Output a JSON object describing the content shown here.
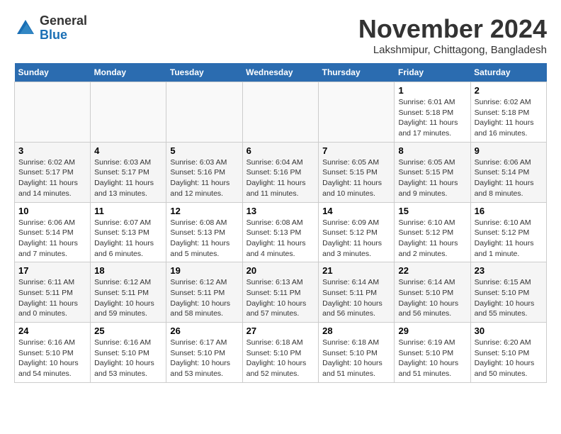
{
  "logo": {
    "general": "General",
    "blue": "Blue"
  },
  "header": {
    "month": "November 2024",
    "location": "Lakshmipur, Chittagong, Bangladesh"
  },
  "weekdays": [
    "Sunday",
    "Monday",
    "Tuesday",
    "Wednesday",
    "Thursday",
    "Friday",
    "Saturday"
  ],
  "weeks": [
    [
      {
        "day": "",
        "info": ""
      },
      {
        "day": "",
        "info": ""
      },
      {
        "day": "",
        "info": ""
      },
      {
        "day": "",
        "info": ""
      },
      {
        "day": "",
        "info": ""
      },
      {
        "day": "1",
        "info": "Sunrise: 6:01 AM\nSunset: 5:18 PM\nDaylight: 11 hours\nand 17 minutes."
      },
      {
        "day": "2",
        "info": "Sunrise: 6:02 AM\nSunset: 5:18 PM\nDaylight: 11 hours\nand 16 minutes."
      }
    ],
    [
      {
        "day": "3",
        "info": "Sunrise: 6:02 AM\nSunset: 5:17 PM\nDaylight: 11 hours\nand 14 minutes."
      },
      {
        "day": "4",
        "info": "Sunrise: 6:03 AM\nSunset: 5:17 PM\nDaylight: 11 hours\nand 13 minutes."
      },
      {
        "day": "5",
        "info": "Sunrise: 6:03 AM\nSunset: 5:16 PM\nDaylight: 11 hours\nand 12 minutes."
      },
      {
        "day": "6",
        "info": "Sunrise: 6:04 AM\nSunset: 5:16 PM\nDaylight: 11 hours\nand 11 minutes."
      },
      {
        "day": "7",
        "info": "Sunrise: 6:05 AM\nSunset: 5:15 PM\nDaylight: 11 hours\nand 10 minutes."
      },
      {
        "day": "8",
        "info": "Sunrise: 6:05 AM\nSunset: 5:15 PM\nDaylight: 11 hours\nand 9 minutes."
      },
      {
        "day": "9",
        "info": "Sunrise: 6:06 AM\nSunset: 5:14 PM\nDaylight: 11 hours\nand 8 minutes."
      }
    ],
    [
      {
        "day": "10",
        "info": "Sunrise: 6:06 AM\nSunset: 5:14 PM\nDaylight: 11 hours\nand 7 minutes."
      },
      {
        "day": "11",
        "info": "Sunrise: 6:07 AM\nSunset: 5:13 PM\nDaylight: 11 hours\nand 6 minutes."
      },
      {
        "day": "12",
        "info": "Sunrise: 6:08 AM\nSunset: 5:13 PM\nDaylight: 11 hours\nand 5 minutes."
      },
      {
        "day": "13",
        "info": "Sunrise: 6:08 AM\nSunset: 5:13 PM\nDaylight: 11 hours\nand 4 minutes."
      },
      {
        "day": "14",
        "info": "Sunrise: 6:09 AM\nSunset: 5:12 PM\nDaylight: 11 hours\nand 3 minutes."
      },
      {
        "day": "15",
        "info": "Sunrise: 6:10 AM\nSunset: 5:12 PM\nDaylight: 11 hours\nand 2 minutes."
      },
      {
        "day": "16",
        "info": "Sunrise: 6:10 AM\nSunset: 5:12 PM\nDaylight: 11 hours\nand 1 minute."
      }
    ],
    [
      {
        "day": "17",
        "info": "Sunrise: 6:11 AM\nSunset: 5:11 PM\nDaylight: 11 hours\nand 0 minutes."
      },
      {
        "day": "18",
        "info": "Sunrise: 6:12 AM\nSunset: 5:11 PM\nDaylight: 10 hours\nand 59 minutes."
      },
      {
        "day": "19",
        "info": "Sunrise: 6:12 AM\nSunset: 5:11 PM\nDaylight: 10 hours\nand 58 minutes."
      },
      {
        "day": "20",
        "info": "Sunrise: 6:13 AM\nSunset: 5:11 PM\nDaylight: 10 hours\nand 57 minutes."
      },
      {
        "day": "21",
        "info": "Sunrise: 6:14 AM\nSunset: 5:11 PM\nDaylight: 10 hours\nand 56 minutes."
      },
      {
        "day": "22",
        "info": "Sunrise: 6:14 AM\nSunset: 5:10 PM\nDaylight: 10 hours\nand 56 minutes."
      },
      {
        "day": "23",
        "info": "Sunrise: 6:15 AM\nSunset: 5:10 PM\nDaylight: 10 hours\nand 55 minutes."
      }
    ],
    [
      {
        "day": "24",
        "info": "Sunrise: 6:16 AM\nSunset: 5:10 PM\nDaylight: 10 hours\nand 54 minutes."
      },
      {
        "day": "25",
        "info": "Sunrise: 6:16 AM\nSunset: 5:10 PM\nDaylight: 10 hours\nand 53 minutes."
      },
      {
        "day": "26",
        "info": "Sunrise: 6:17 AM\nSunset: 5:10 PM\nDaylight: 10 hours\nand 53 minutes."
      },
      {
        "day": "27",
        "info": "Sunrise: 6:18 AM\nSunset: 5:10 PM\nDaylight: 10 hours\nand 52 minutes."
      },
      {
        "day": "28",
        "info": "Sunrise: 6:18 AM\nSunset: 5:10 PM\nDaylight: 10 hours\nand 51 minutes."
      },
      {
        "day": "29",
        "info": "Sunrise: 6:19 AM\nSunset: 5:10 PM\nDaylight: 10 hours\nand 51 minutes."
      },
      {
        "day": "30",
        "info": "Sunrise: 6:20 AM\nSunset: 5:10 PM\nDaylight: 10 hours\nand 50 minutes."
      }
    ]
  ]
}
